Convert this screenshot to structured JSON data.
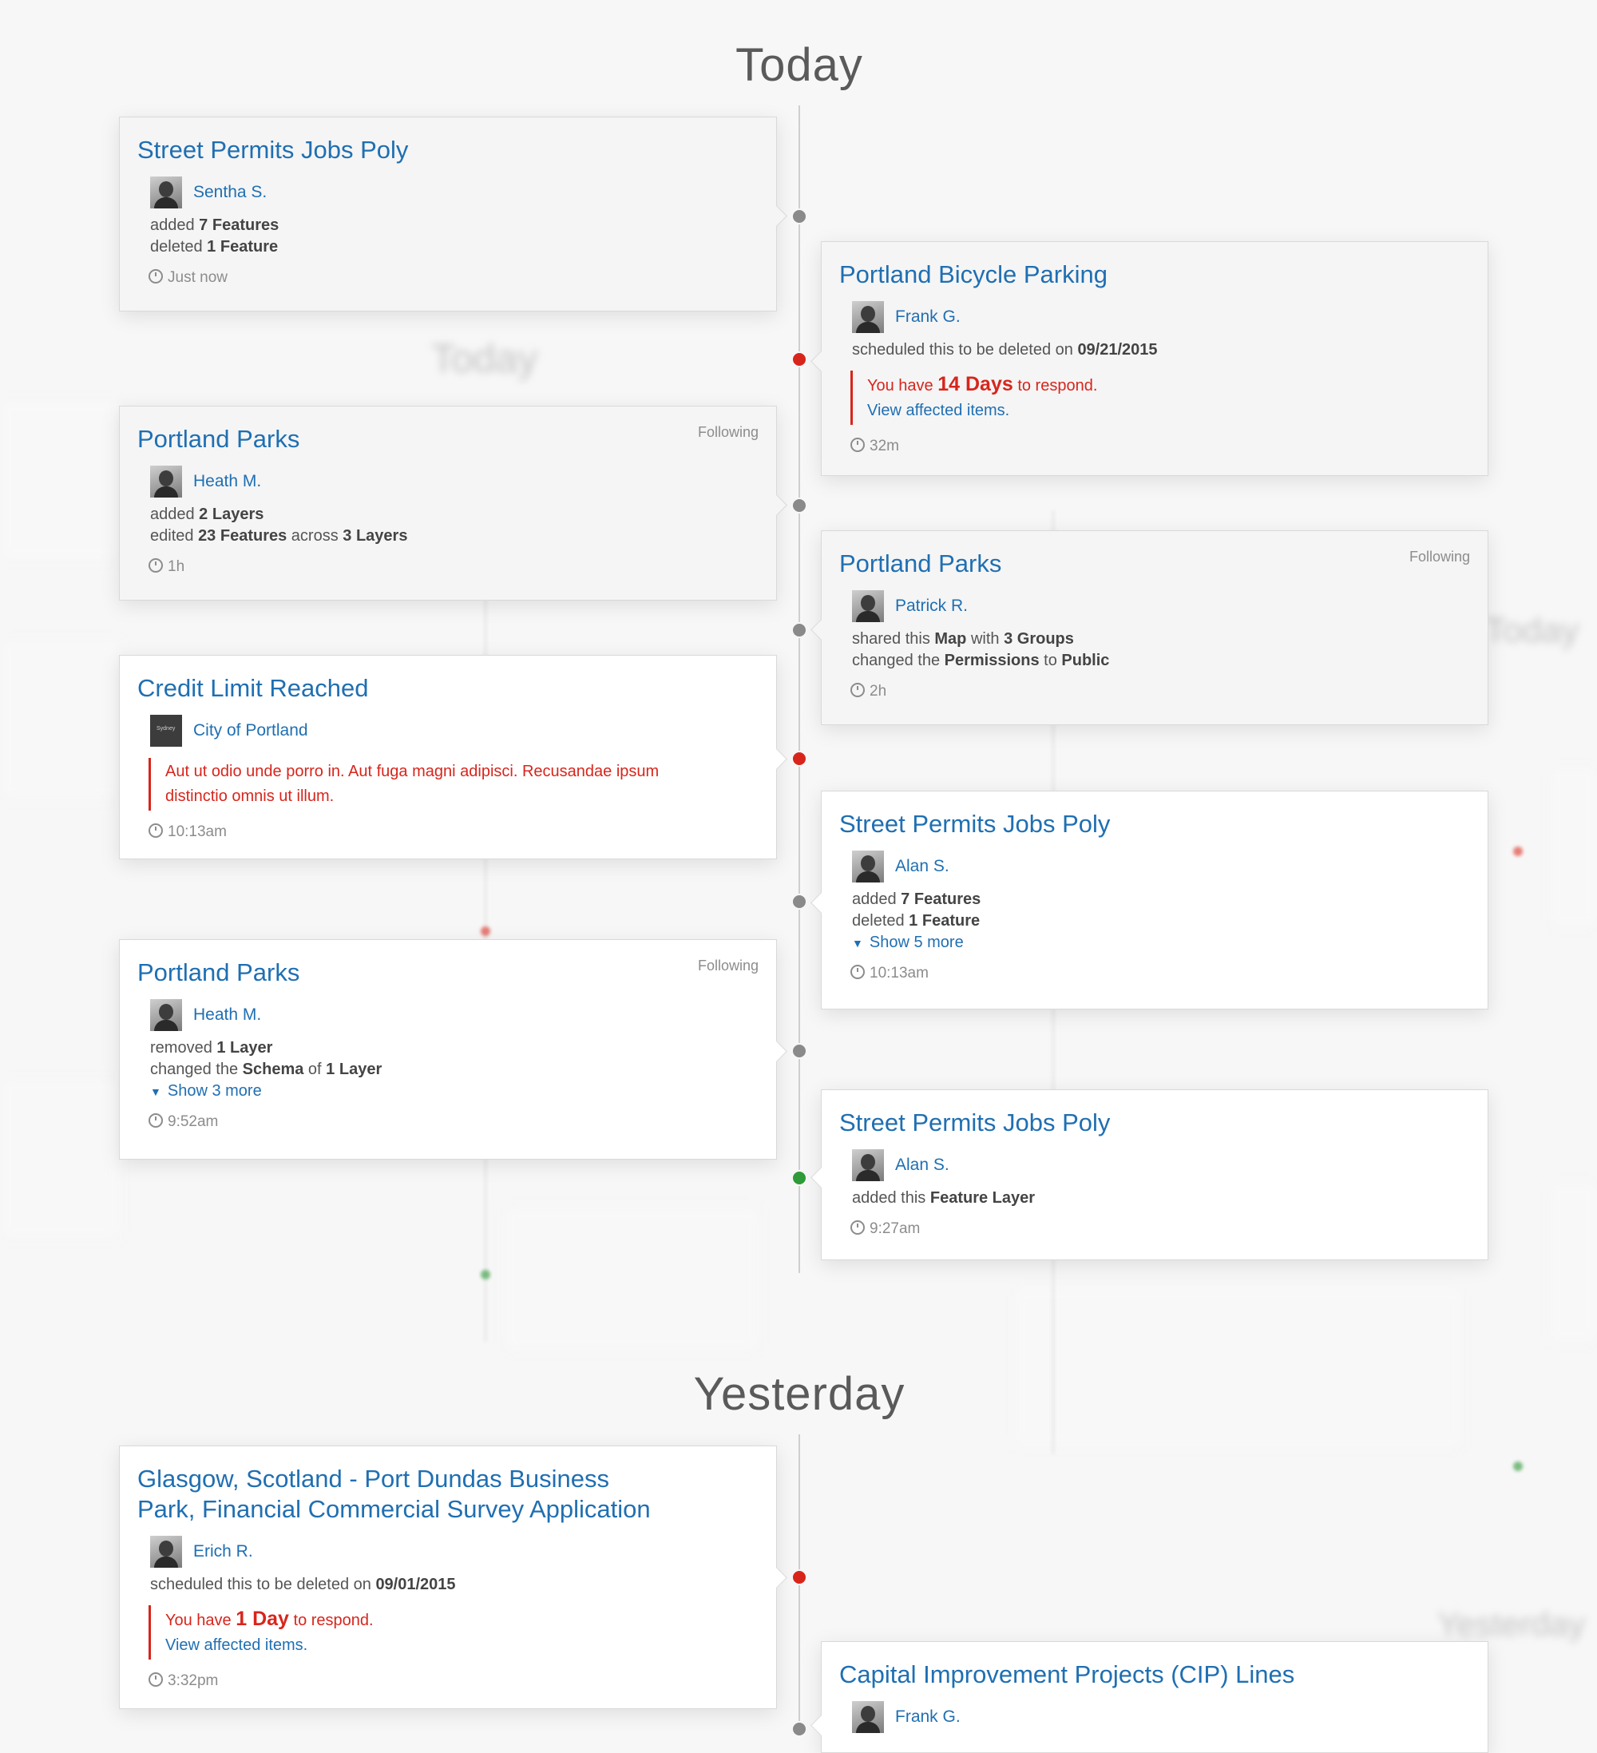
{
  "headings": {
    "today": "Today",
    "yesterday": "Yesterday"
  },
  "colors": {
    "link": "#1f6fb2",
    "alert": "#d8251c",
    "dot_gray": "#8a8a8a",
    "dot_red": "#d8251c",
    "dot_green": "#2f9a38"
  },
  "cards": [
    {
      "title": "Street Permits Jobs Poly",
      "user": "Sentha S.",
      "lines": [
        "added <b>7 Features</b>",
        "deleted <b>1 Feature</b>"
      ],
      "time": "Just now"
    },
    {
      "title": "Portland Bicycle Parking",
      "user": "Frank G.",
      "lines": [
        "scheduled this to be deleted on <b>09/21/2015</b>"
      ],
      "alert_pre": "You have ",
      "alert_big": "14 Days",
      "alert_post": " to respond.",
      "alert_link": "View affected items.",
      "time": "32m"
    },
    {
      "title": "Portland Parks",
      "following": "Following",
      "user": "Heath M.",
      "lines": [
        "added <b>2 Layers</b>",
        "edited <b>23 Features</b> across <b>3 Layers</b>"
      ],
      "time": "1h"
    },
    {
      "title": "Portland Parks",
      "following": "Following",
      "user": "Patrick R.",
      "lines": [
        "shared this <b>Map</b> with <b>3 Groups</b>",
        "changed the <b>Permissions</b> to <b>Public</b>"
      ],
      "time": "2h"
    },
    {
      "title": "Credit Limit Reached",
      "user": "City of Portland",
      "alert_text": "Aut ut odio unde porro in. Aut fuga magni adipisci. Recusandae ipsum distinctio omnis ut illum.",
      "time": "10:13am"
    },
    {
      "title": "Street Permits Jobs Poly",
      "user": "Alan S.",
      "lines": [
        "added <b>7 Features</b>",
        "deleted <b>1 Feature</b>"
      ],
      "show_more": "Show 5 more",
      "time": "10:13am"
    },
    {
      "title": "Portland Parks",
      "following": "Following",
      "user": "Heath M.",
      "lines": [
        "removed <b>1 Layer</b>",
        "changed the <b>Schema</b> of <b>1 Layer</b>"
      ],
      "show_more": "Show 3 more",
      "time": "9:52am"
    },
    {
      "title": "Street Permits Jobs Poly",
      "user": "Alan S.",
      "lines": [
        "added this <b>Feature Layer</b>"
      ],
      "time": "9:27am"
    },
    {
      "title": "Glasgow, Scotland - Port Dundas Business Park, Financial Commercial Survey Application",
      "user": "Erich R.",
      "lines": [
        "scheduled this to be deleted on <b>09/01/2015</b>"
      ],
      "alert_pre": "You have ",
      "alert_big": "1 Day",
      "alert_post": " to respond.",
      "alert_link": "View affected items.",
      "time": "3:32pm"
    },
    {
      "title": "Capital Improvement Projects (CIP) Lines",
      "user": "Frank G."
    }
  ]
}
